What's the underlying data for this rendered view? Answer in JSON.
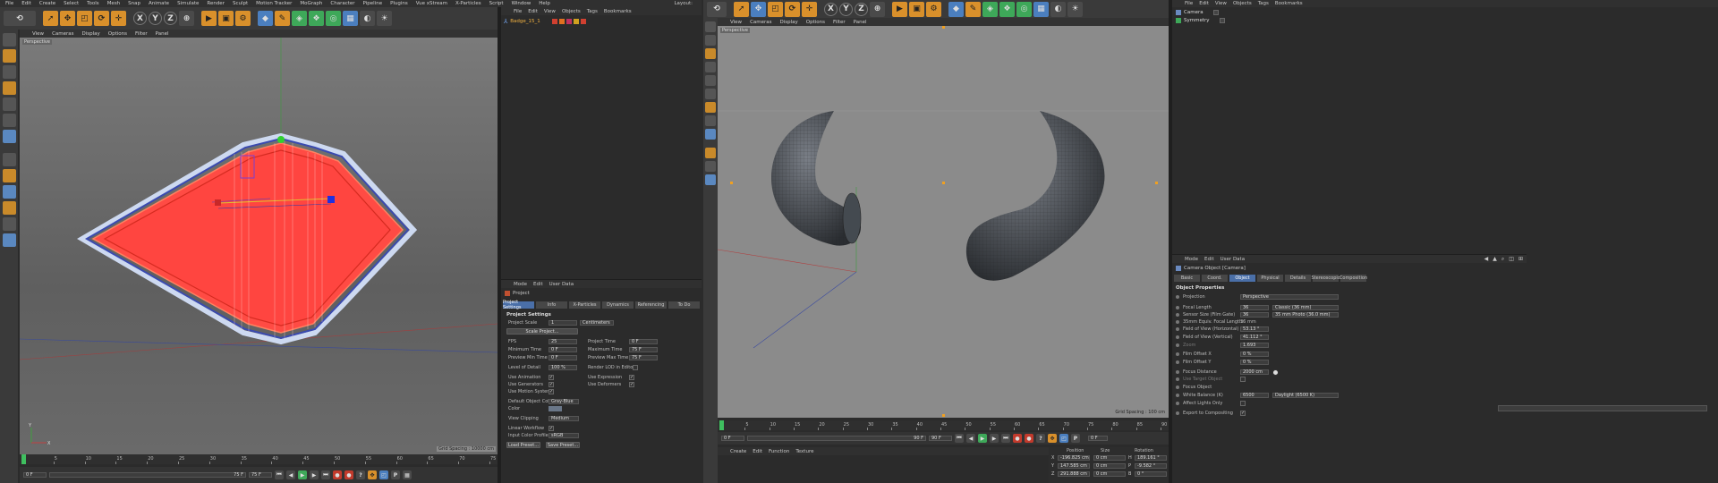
{
  "left_window": {
    "menu": [
      "File",
      "Edit",
      "Create",
      "Select",
      "Tools",
      "Mesh",
      "Snap",
      "Animate",
      "Simulate",
      "Render",
      "Sculpt",
      "Motion Tracker",
      "MoGraph",
      "Character",
      "Pipeline",
      "Plugins",
      "Vue xStream",
      "X-Particles",
      "Script",
      "Window",
      "Help"
    ],
    "layout_label": "Layout:",
    "toolbar_icons": [
      "undo-icon",
      "select-arrow-icon",
      "move-icon",
      "scale-icon",
      "rotate-icon",
      "live-select-icon",
      "x-axis-icon",
      "y-axis-icon",
      "z-axis-icon",
      "world-coords-icon",
      "render-view-icon",
      "render-picture-viewer-icon",
      "render-settings-icon",
      "cube-icon",
      "spline-pen-icon",
      "subdivision-icon",
      "cloner-icon",
      "bend-deformer-icon",
      "floor-icon",
      "camera-icon",
      "light-icon"
    ],
    "axis_labels": [
      "X",
      "Y",
      "Z"
    ],
    "viewport_menu": [
      "View",
      "Cameras",
      "Display",
      "Options",
      "Filter",
      "Panel"
    ],
    "viewport_label": "Perspective",
    "grid_spacing": "Grid Spacing : 10000 cm",
    "axis_gizmo": {
      "y": "Y",
      "x": "X",
      "z": "Z"
    },
    "timeline_ticks": [
      "0",
      "5",
      "10",
      "15",
      "20",
      "25",
      "30",
      "35",
      "40",
      "45",
      "50",
      "55",
      "60",
      "65",
      "70",
      "75"
    ],
    "frame_start": "0 F",
    "frame_mid": "75 F",
    "frame_end": "75 F",
    "frame_cur": "0 F",
    "object_manager": {
      "menu": [
        "File",
        "Edit",
        "View",
        "Objects",
        "Tags",
        "Bookmarks"
      ],
      "object_name": "Badge_15_1"
    },
    "attributes": {
      "menu": [
        "Mode",
        "Edit",
        "User Data"
      ],
      "object_title": "Project",
      "tabs": [
        "Project Settings",
        "Info",
        "X-Particles",
        "Dynamics",
        "Referencing",
        "To Do"
      ],
      "section": "Project Settings",
      "project_scale_label": "Project Scale",
      "project_scale_value": "1",
      "project_scale_unit": "Centimeters",
      "scale_project_btn": "Scale Project...",
      "fps_label": "FPS",
      "fps_value": "25",
      "project_time_label": "Project Time",
      "project_time_value": "0 F",
      "min_time_label": "Minimum Time",
      "min_time_value": "0 F",
      "max_time_label": "Maximum Time",
      "max_time_value": "75 F",
      "preview_min_label": "Preview Min Time",
      "preview_min_value": "0 F",
      "preview_max_label": "Preview Max Time",
      "preview_max_value": "75 F",
      "lod_label": "Level of Detail",
      "lod_value": "100 %",
      "render_lod_label": "Render LOD in Editor",
      "use_animation": "Use Animation",
      "use_expression": "Use Expression",
      "use_generators": "Use Generators",
      "use_deformers": "Use Deformers",
      "use_motion_system": "Use Motion System",
      "default_obj_color_label": "Default Object Color",
      "default_obj_color_value": "Gray-Blue",
      "color_label": "Color",
      "view_clipping_label": "View Clipping",
      "view_clipping_value": "Medium",
      "linear_workflow_label": "Linear Workflow",
      "input_color_profile_label": "Input Color Profile",
      "input_color_profile_value": "sRGB",
      "load_preset": "Load Preset...",
      "save_preset": "Save Preset..."
    }
  },
  "right_window": {
    "menu": [
      "File",
      "Edit",
      "View",
      "Objects",
      "Tags",
      "Bookmarks"
    ],
    "viewport_menu": [
      "View",
      "Cameras",
      "Display",
      "Options",
      "Filter",
      "Panel"
    ],
    "viewport_label": "Perspective",
    "grid_spacing": "Grid Spacing : 100 cm",
    "objects": [
      {
        "name": "Camera",
        "icon": "camera-icon"
      },
      {
        "name": "Symmetry",
        "icon": "symmetry-icon"
      }
    ],
    "timeline_ticks": [
      "0",
      "5",
      "10",
      "15",
      "20",
      "25",
      "30",
      "35",
      "40",
      "45",
      "50",
      "55",
      "60",
      "65",
      "70",
      "75",
      "80",
      "85",
      "90"
    ],
    "frame_cur": "0 F",
    "frame_mid": "90 F",
    "frame_end": "90 F",
    "frame_right": "0 F",
    "material_menu": [
      "Create",
      "Edit",
      "Function",
      "Texture"
    ],
    "coord_headers": [
      "Position",
      "Size",
      "Rotation"
    ],
    "coords": [
      {
        "axis": "X",
        "pos": "-196.825 cm",
        "size": "0 cm",
        "rot": "H",
        "rotv": "189.161 °"
      },
      {
        "axis": "Y",
        "pos": "147.585 cm",
        "size": "0 cm",
        "rot": "P",
        "rotv": "-9.582 °"
      },
      {
        "axis": "Z",
        "pos": "291.888 cm",
        "size": "0 cm",
        "rot": "B",
        "rotv": "0 °"
      }
    ],
    "attributes": {
      "menu": [
        "Mode",
        "Edit",
        "User Data"
      ],
      "object_title": "Camera Object [Camera]",
      "tabs": [
        "Basic",
        "Coord.",
        "Object",
        "Physical",
        "Details",
        "Stereoscopic",
        "Composition"
      ],
      "section": "Object Properties",
      "projection_label": "Projection",
      "projection_value": "Perspective",
      "focal_label": "Focal Length",
      "focal_value": "36",
      "focal_preset": "Classic (36 mm)",
      "sensor_label": "Sensor Size (Film Gate)",
      "sensor_value": "36",
      "sensor_preset": "35 mm Photo (36.0 mm)",
      "equiv_label": "35mm Equiv. Focal Length:",
      "equiv_value": "36 mm",
      "fov_h_label": "Field of View (Horizontal)",
      "fov_h_value": "53.13 °",
      "fov_v_label": "Field of View (Vertical)",
      "fov_v_value": "41.112 °",
      "zoom_label": "Zoom",
      "zoom_value": "1.693",
      "film_x_label": "Film Offset X",
      "film_x_value": "0 %",
      "film_y_label": "Film Offset Y",
      "film_y_value": "0 %",
      "focus_dist_label": "Focus Distance",
      "focus_dist_value": "2000 cm",
      "use_target_label": "Use Target Object",
      "focus_obj_label": "Focus Object",
      "wb_label": "White Balance (K)",
      "wb_value": "6500",
      "wb_preset": "Daylight (6500 K)",
      "affect_lights_label": "Affect Lights Only",
      "export_label": "Export to Compositing"
    }
  }
}
